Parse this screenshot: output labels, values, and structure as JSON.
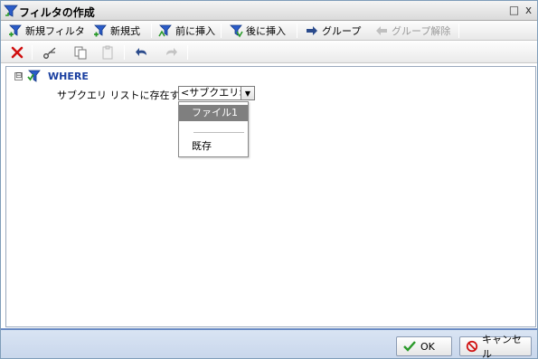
{
  "window": {
    "title": "フィルタの作成",
    "minimize_glyph": "□",
    "close_glyph": "x"
  },
  "toolbar": {
    "new_filter": "新規フィルタ",
    "new_expression": "新規式",
    "insert_before": "前に挿入",
    "insert_after": "後に挿入",
    "group": "グループ",
    "ungroup": "グループ解除"
  },
  "edit_toolbar": {
    "icons": [
      "delete-icon",
      "cut-icon",
      "copy-icon",
      "paste-icon",
      "undo-icon",
      "redo-icon"
    ]
  },
  "tree": {
    "toggle": "⊟",
    "root_label": "WHERE",
    "condition_text": "サブクエリ リストに存在する",
    "combo_value": "<サブクエリ>",
    "dropdown": {
      "options": [
        "ファイル1",
        "既存"
      ],
      "selected_index": 0
    }
  },
  "footer": {
    "ok_label": "OK",
    "cancel_label": "キャンセル"
  },
  "colors": {
    "accent": "#1a3fa0",
    "footer_border": "#6a8bc4",
    "delete_red": "#d01010",
    "ok_green": "#2a9a2a"
  }
}
